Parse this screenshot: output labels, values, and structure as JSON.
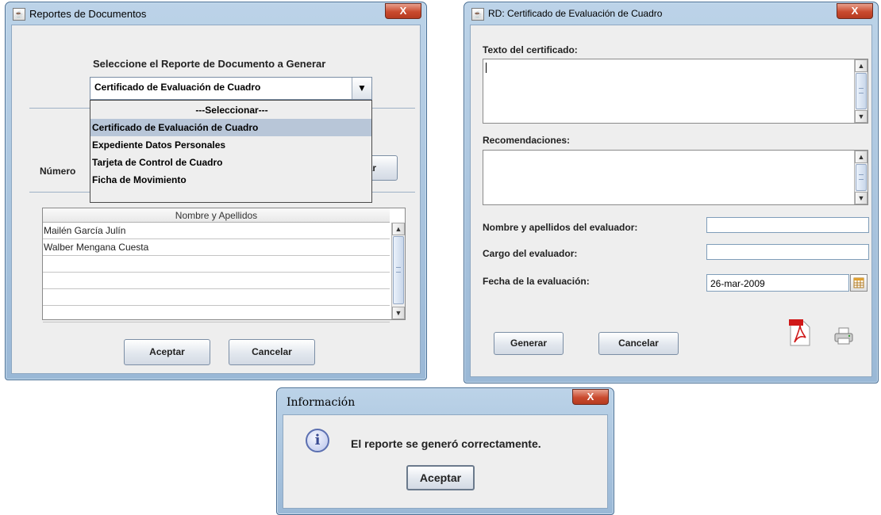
{
  "reportes": {
    "title": "Reportes de Documentos",
    "close": "X",
    "heading": "Seleccione el Reporte de Documento a Generar",
    "combo_value": "Certificado de Evaluación de Cuadro",
    "options": [
      "---Seleccionar---",
      "Certificado de Evaluación de Cuadro",
      "Expediente Datos Personales",
      "Tarjeta de Control de Cuadro",
      "Ficha de Movimiento"
    ],
    "numero_label": "Número",
    "buscar_fragment": "ar",
    "table_header": "Nombre y Apellidos",
    "rows": [
      "Mailén García Julín",
      "Walber Mengana Cuesta",
      "",
      "",
      "",
      ""
    ],
    "accept": "Aceptar",
    "cancel": "Cancelar"
  },
  "certificado": {
    "title": "RD: Certificado de Evaluación de Cuadro",
    "close": "X",
    "texto_label": "Texto del certificado:",
    "recomendaciones_label": "Recomendaciones:",
    "nombre_label": "Nombre y apellidos del evaluador:",
    "cargo_label": "Cargo del evaluador:",
    "fecha_label": "Fecha de la evaluación:",
    "fecha_value": "26-mar-2009",
    "generar": "Generar",
    "cancelar": "Cancelar"
  },
  "info": {
    "title": "Información",
    "close": "X",
    "message": "El reporte se generó correctamente.",
    "accept": "Aceptar"
  }
}
